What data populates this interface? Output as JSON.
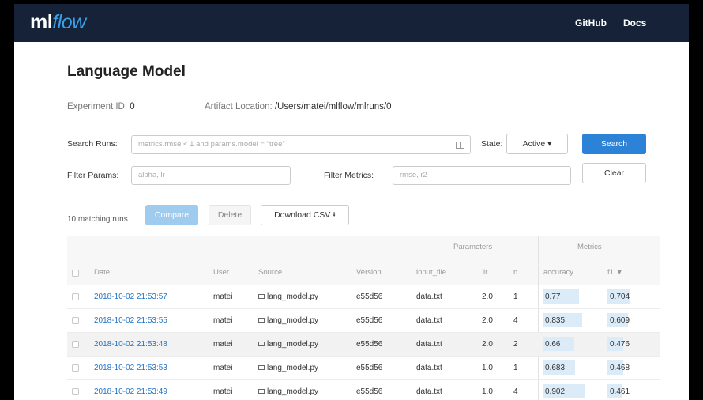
{
  "navbar": {
    "logo_ml": "ml",
    "logo_flow": "flow",
    "links": [
      "GitHub",
      "Docs"
    ]
  },
  "page": {
    "title": "Language Model",
    "experiment_id_label": "Experiment ID:",
    "experiment_id": "0",
    "artifact_label": "Artifact Location:",
    "artifact_path": "/Users/matei/mlflow/mlruns/0"
  },
  "search": {
    "label": "Search Runs:",
    "placeholder": "metrics.rmse < 1 and params.model = \"tree\"",
    "state_label": "State:",
    "state_value": "Active ▾",
    "search_button": "Search"
  },
  "filters": {
    "params_label": "Filter Params:",
    "params_placeholder": "alpha, lr",
    "metrics_label": "Filter Metrics:",
    "metrics_placeholder": "rmse, r2",
    "clear_button": "Clear"
  },
  "toolbar": {
    "count_text": "10 matching runs",
    "compare": "Compare",
    "delete": "Delete",
    "download": "Download CSV"
  },
  "table": {
    "group_headers": {
      "parameters": "Parameters",
      "metrics": "Metrics"
    },
    "headers": {
      "date": "Date",
      "user": "User",
      "source": "Source",
      "version": "Version",
      "input_file": "input_file",
      "lr": "lr",
      "n": "n",
      "accuracy": "accuracy",
      "f1": "f1 ▼"
    },
    "rows": [
      {
        "date": "2018-10-02 21:53:57",
        "user": "matei",
        "source": "lang_model.py",
        "version": "e55d56",
        "input_file": "data.txt",
        "lr": "2.0",
        "n": "1",
        "accuracy": "0.77",
        "f1": "0.704",
        "acc_frac": 0.77,
        "f1_frac": 0.7
      },
      {
        "date": "2018-10-02 21:53:55",
        "user": "matei",
        "source": "lang_model.py",
        "version": "e55d56",
        "input_file": "data.txt",
        "lr": "2.0",
        "n": "4",
        "accuracy": "0.835",
        "f1": "0.609",
        "acc_frac": 0.835,
        "f1_frac": 0.61
      },
      {
        "date": "2018-10-02 21:53:48",
        "user": "matei",
        "source": "lang_model.py",
        "version": "e55d56",
        "input_file": "data.txt",
        "lr": "2.0",
        "n": "2",
        "accuracy": "0.66",
        "f1": "0.476",
        "acc_frac": 0.66,
        "f1_frac": 0.48
      },
      {
        "date": "2018-10-02 21:53:53",
        "user": "matei",
        "source": "lang_model.py",
        "version": "e55d56",
        "input_file": "data.txt",
        "lr": "1.0",
        "n": "1",
        "accuracy": "0.683",
        "f1": "0.468",
        "acc_frac": 0.683,
        "f1_frac": 0.47
      },
      {
        "date": "2018-10-02 21:53:49",
        "user": "matei",
        "source": "lang_model.py",
        "version": "e55d56",
        "input_file": "data.txt",
        "lr": "1.0",
        "n": "4",
        "accuracy": "0.902",
        "f1": "0.461",
        "acc_frac": 0.902,
        "f1_frac": 0.46
      }
    ]
  },
  "colors": {
    "navbar": "#152238",
    "accent": "#2b82d6",
    "link": "#2374c6",
    "metric_bar": "#dcebf8"
  }
}
